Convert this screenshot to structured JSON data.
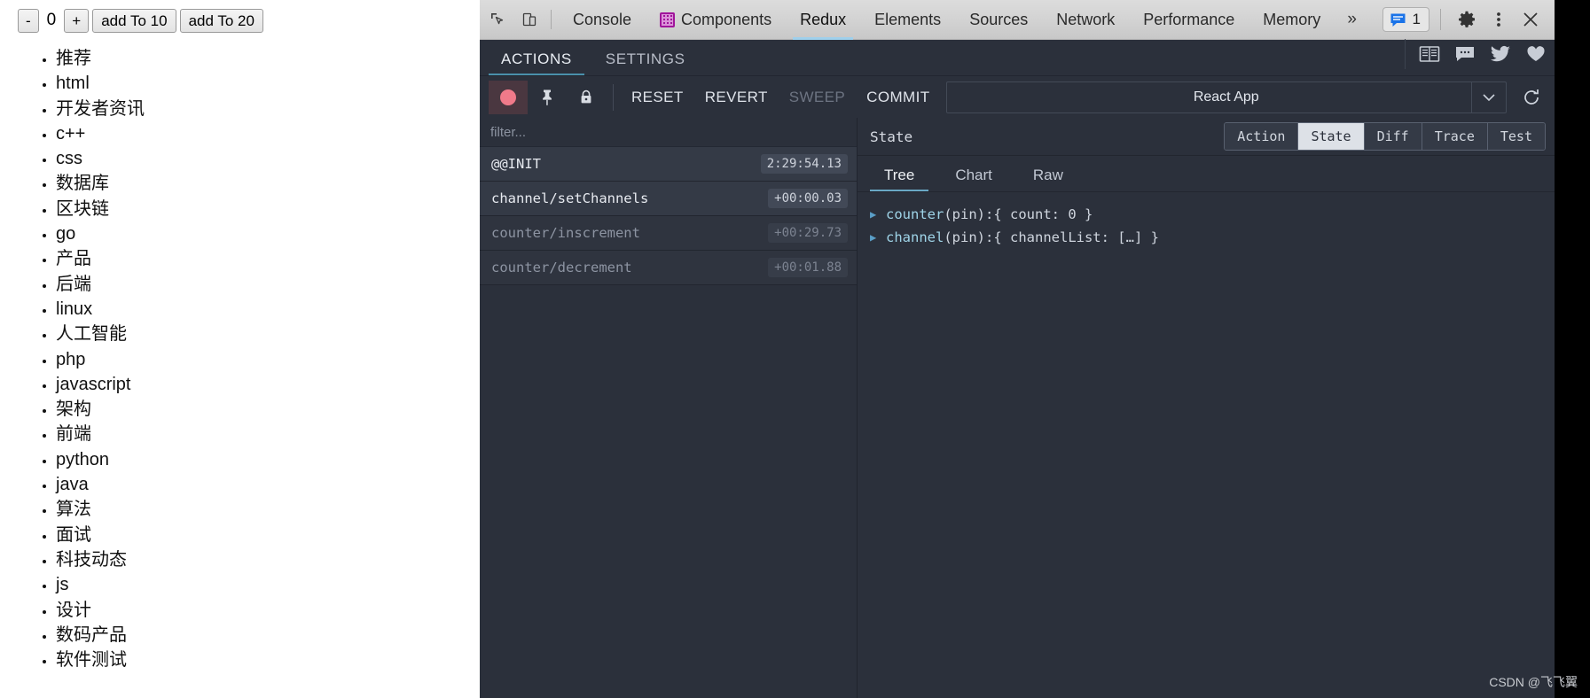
{
  "page": {
    "toolbar": {
      "decrement_label": "-",
      "counter_value": "0",
      "increment_label": "+",
      "add_to_10_label": "add To 10",
      "add_to_20_label": "add To 20"
    },
    "topics": [
      "推荐",
      "html",
      "开发者资讯",
      "c++",
      "css",
      "数据库",
      "区块链",
      "go",
      "产品",
      "后端",
      "linux",
      "人工智能",
      "php",
      "javascript",
      "架构",
      "前端",
      "python",
      "java",
      "算法",
      "面试",
      "科技动态",
      "js",
      "设计",
      "数码产品",
      "软件测试"
    ]
  },
  "devtools": {
    "tabs": [
      {
        "label": "Console",
        "active": false,
        "icon": null
      },
      {
        "label": "Components",
        "active": false,
        "icon": "react-components-icon"
      },
      {
        "label": "Redux",
        "active": true,
        "icon": null
      },
      {
        "label": "Elements",
        "active": false,
        "icon": null
      },
      {
        "label": "Sources",
        "active": false,
        "icon": null
      },
      {
        "label": "Network",
        "active": false,
        "icon": null
      },
      {
        "label": "Performance",
        "active": false,
        "icon": null
      },
      {
        "label": "Memory",
        "active": false,
        "icon": null
      }
    ],
    "overflow_label": "»",
    "message_count": "1",
    "icons": {
      "inspect": "inspect-element-icon",
      "device": "device-toolbar-icon",
      "messages": "messages-icon",
      "settings": "gear-icon",
      "more": "kebab-menu-icon",
      "close": "close-icon"
    }
  },
  "redux": {
    "tabs": [
      {
        "label": "ACTIONS",
        "active": true
      },
      {
        "label": "SETTINGS",
        "active": false
      }
    ],
    "toolbar": {
      "record": "record-icon",
      "pin": "pin-icon",
      "lock": "lock-icon",
      "reset_label": "RESET",
      "revert_label": "REVERT",
      "sweep_label": "SWEEP",
      "commit_label": "COMMIT",
      "instance_label": "React App",
      "chevron": "chevron-down-icon",
      "refresh": "refresh-icon"
    },
    "links": [
      "book-icon",
      "chat-icon",
      "twitter-icon",
      "heart-icon"
    ],
    "filter_placeholder": "filter...",
    "actions": [
      {
        "name": "@@INIT",
        "time": "2:29:54.13",
        "dim": false
      },
      {
        "name": "channel/setChannels",
        "time": "+00:00.03",
        "dim": false
      },
      {
        "name": "counter/inscrement",
        "time": "+00:29.73",
        "dim": true
      },
      {
        "name": "counter/decrement",
        "time": "+00:01.88",
        "dim": true
      }
    ],
    "state_panel": {
      "title": "State",
      "segments": [
        {
          "label": "Action",
          "active": false
        },
        {
          "label": "State",
          "active": true
        },
        {
          "label": "Diff",
          "active": false
        },
        {
          "label": "Trace",
          "active": false
        },
        {
          "label": "Test",
          "active": false
        }
      ],
      "subtabs": [
        {
          "label": "Tree",
          "active": true
        },
        {
          "label": "Chart",
          "active": false
        },
        {
          "label": "Raw",
          "active": false
        }
      ],
      "tree": [
        {
          "key": "counter",
          "pin": " (pin): ",
          "value": "{ count: 0 }"
        },
        {
          "key": "channel",
          "pin": " (pin): ",
          "value": "{ channelList: […] }"
        }
      ]
    }
  },
  "watermark": "CSDN @飞飞翼",
  "colors": {
    "devtools_bg": "#2b303b",
    "tabbar_bg": "#d2d2d2",
    "accent_blue": "#6aa8c4",
    "record_pink": "#f07a8a",
    "components_purple": "#a0159b"
  }
}
